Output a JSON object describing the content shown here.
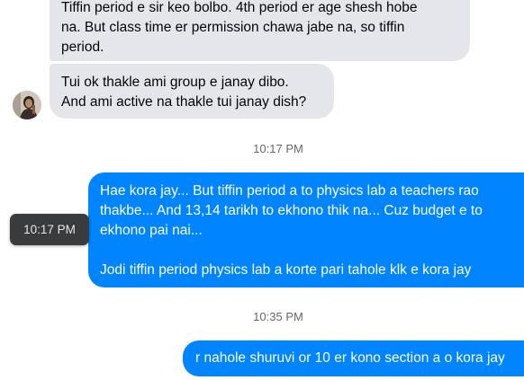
{
  "messages": [
    {
      "direction": "incoming",
      "text": "Tiffin period e sir keo bolbo. 4th period er age shesh hobe\nna. But class time er permission chawa jabe na, so tiffin\nperiod."
    },
    {
      "direction": "incoming",
      "text": "Tui ok thakle ami group e janay dibo.\nAnd ami active na thakle tui janay dish?"
    },
    {
      "direction": "outgoing",
      "text": "Hae kora jay... But tiffin period a to physics lab a teachers rao\nthakbe... And 13,14 tarikh to ekhono thik na... Cuz budget e to\nekhono pai nai...\n\nJodi tiffin period physics lab a korte pari tahole klk e kora jay"
    },
    {
      "direction": "outgoing",
      "text": "r nahole shuruvi or 10 er kono section a o kora jay"
    }
  ],
  "timestamps": [
    "10:17 PM",
    "10:35 PM"
  ],
  "tooltip": "10:17 PM",
  "colors": {
    "outgoing_bubble": "#0084ff",
    "incoming_bubble": "#e4e6eb",
    "timestamp_text": "#65676b",
    "tooltip_bg": "#3a3b3c"
  }
}
